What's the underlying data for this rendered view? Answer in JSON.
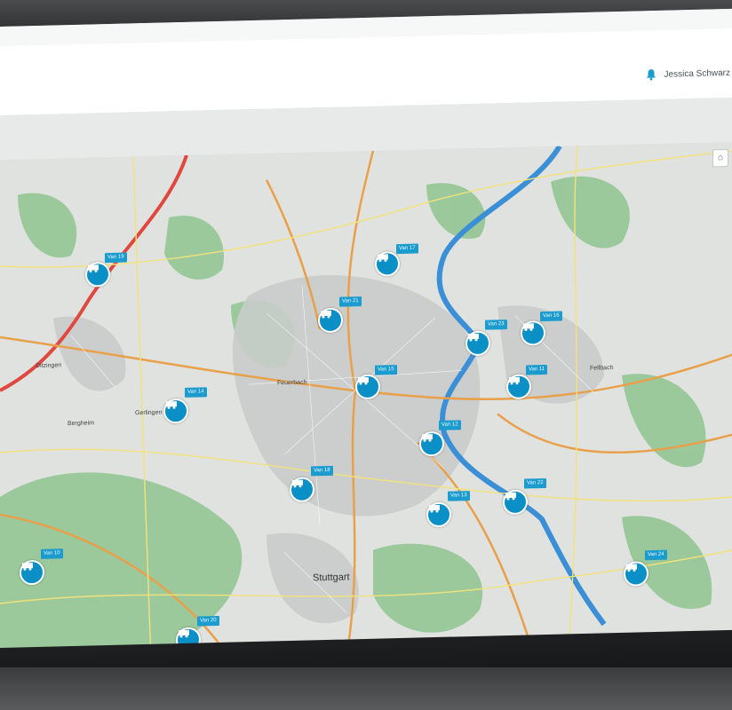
{
  "header": {
    "user_name": "Jessica Schwarz",
    "bell_icon": "bell-icon",
    "accent_color": "#1c9cce"
  },
  "map": {
    "city_label": "Stuttgart",
    "places": [
      {
        "label": "Fellbach"
      },
      {
        "label": "Feuerbach"
      },
      {
        "label": "Gerlingen"
      },
      {
        "label": "Bergheim"
      },
      {
        "label": "Ditzingen"
      }
    ],
    "vehicles": [
      {
        "label": "Van 19"
      },
      {
        "label": "Van 17"
      },
      {
        "label": "Van 21"
      },
      {
        "label": "Van 23"
      },
      {
        "label": "Van 16"
      },
      {
        "label": "Van 15"
      },
      {
        "label": "Van 11"
      },
      {
        "label": "Van 14"
      },
      {
        "label": "Van 12"
      },
      {
        "label": "Van 18"
      },
      {
        "label": "Van 13"
      },
      {
        "label": "Van 22"
      },
      {
        "label": "Van 20"
      },
      {
        "label": "Van 10"
      },
      {
        "label": "Van 24"
      }
    ],
    "control_icon": "layers-icon"
  }
}
